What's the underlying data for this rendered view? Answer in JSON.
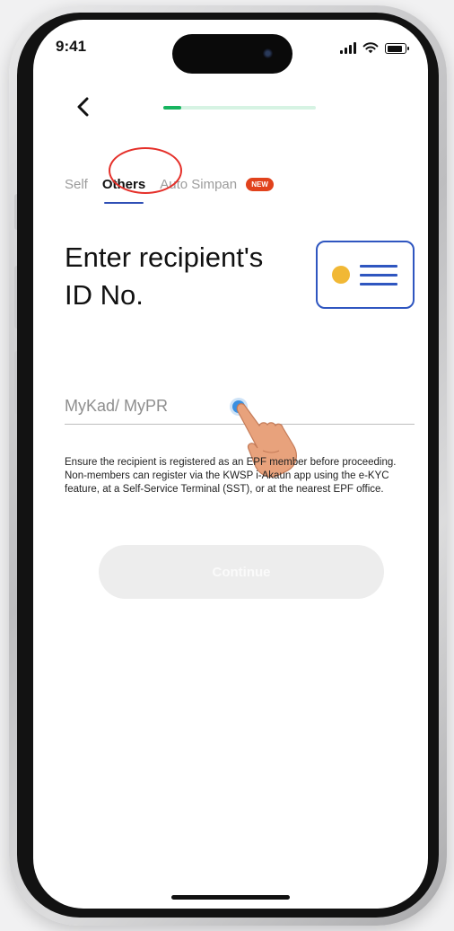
{
  "status_bar": {
    "time": "9:41",
    "icons": [
      "signal-icon",
      "wifi-icon",
      "battery-icon"
    ]
  },
  "header": {
    "back_icon": "chevron-left-icon",
    "progress_fraction": 0.12
  },
  "tabs": [
    {
      "label": "Self",
      "active": false
    },
    {
      "label": "Others",
      "active": true
    },
    {
      "label": "Auto Simpan",
      "active": false,
      "badge": "NEW"
    }
  ],
  "main": {
    "title": "Enter recipient's ID No.",
    "id_card_icon": "id-card-icon",
    "id_input": {
      "placeholder": "MyKad/ MyPR",
      "value": ""
    },
    "notice": "Ensure the recipient is registered as an EPF member before proceeding. Non-members can register via the KWSP i-Akaun app using the e-KYC feature, at a Self-Service Terminal (SST), or at the nearest EPF office.",
    "continue_label": "Continue"
  },
  "colors": {
    "accent_blue": "#2f56c0",
    "progress_green": "#17b45f",
    "badge_orange": "#e1421c",
    "annotation_red": "#e5302a",
    "card_dot_yellow": "#f1b835"
  }
}
